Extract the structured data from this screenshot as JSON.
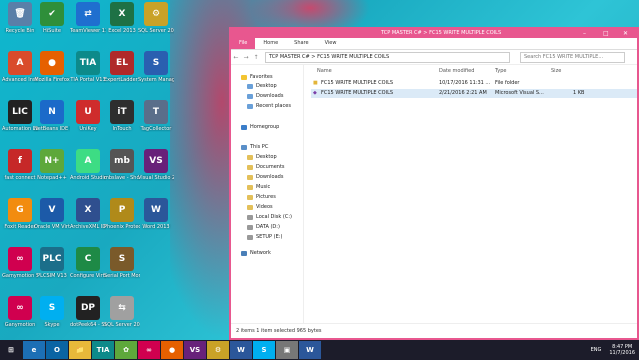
{
  "desktop": {
    "icons": [
      {
        "label": "Recycle Bin",
        "color": "#5a7fa8",
        "glyph": "🗑"
      },
      {
        "label": "HiSuite",
        "color": "#2f8f3a",
        "glyph": "✔"
      },
      {
        "label": "TeamViewer 11",
        "color": "#1f6fcf",
        "glyph": "⇄"
      },
      {
        "label": "Excel 2013",
        "color": "#1e7145",
        "glyph": "X"
      },
      {
        "label": "SQL Server 2014 Manag...",
        "color": "#c9a227",
        "glyph": "⚙"
      },
      {
        "label": "Advanced Installer 12.4",
        "color": "#d94b2b",
        "glyph": "A"
      },
      {
        "label": "Mozilla Firefox",
        "color": "#e66000",
        "glyph": "●"
      },
      {
        "label": "TIA Portal V13",
        "color": "#0d8a8a",
        "glyph": "TIA"
      },
      {
        "label": "ExpertLadder - Shortcut",
        "color": "#b02a2a",
        "glyph": "EL"
      },
      {
        "label": "System Manageme...",
        "color": "#2a5fb0",
        "glyph": "S"
      },
      {
        "label": "Automation License M...",
        "color": "#222",
        "glyph": "LIC"
      },
      {
        "label": "NetBeans IDE 8.2",
        "color": "#1b6ac9",
        "glyph": "N"
      },
      {
        "label": "UniKey",
        "color": "#cf2c2c",
        "glyph": "U"
      },
      {
        "label": "InTouch",
        "color": "#2e2e2e",
        "glyph": "iT"
      },
      {
        "label": "TagCollector",
        "color": "#5a6e8a",
        "glyph": "T"
      },
      {
        "label": "fast connect",
        "color": "#c62828",
        "glyph": "f"
      },
      {
        "label": "Notepad++",
        "color": "#5ea83b",
        "glyph": "N+"
      },
      {
        "label": "Android Studio",
        "color": "#3ddc84",
        "glyph": "A"
      },
      {
        "label": "mbslave - Shortcut",
        "color": "#555",
        "glyph": "mb"
      },
      {
        "label": "Visual Studio 2013",
        "color": "#68217a",
        "glyph": "VS"
      },
      {
        "label": "Foxit Reader",
        "color": "#f28c0f",
        "glyph": "G"
      },
      {
        "label": "Oracle VM VirtualBox",
        "color": "#1c5aa8",
        "glyph": "V"
      },
      {
        "label": "ArchiveXML IDE",
        "color": "#2f4f8f",
        "glyph": "X"
      },
      {
        "label": "Phoenix Protector",
        "color": "#b08a1a",
        "glyph": "P"
      },
      {
        "label": "Word 2013",
        "color": "#2b579a",
        "glyph": "W"
      },
      {
        "label": "Gamymotion Shell",
        "color": "#d0004f",
        "glyph": "∞"
      },
      {
        "label": "PLCSIM V13",
        "color": "#1b6e8a",
        "glyph": "PLC"
      },
      {
        "label": "Configure Virtual Seri...",
        "color": "#1e8a46",
        "glyph": "C"
      },
      {
        "label": "Serial Port Monitor",
        "color": "#7a5a2a",
        "glyph": "S"
      },
      {
        "label": "",
        "color": "transparent",
        "glyph": ""
      },
      {
        "label": "Ganymotion",
        "color": "#d0004f",
        "glyph": "∞"
      },
      {
        "label": "Skype",
        "color": "#00aff0",
        "glyph": "S"
      },
      {
        "label": "dotPeek64 - Shortcut",
        "color": "#222",
        "glyph": "DP"
      },
      {
        "label": "SQL Server 2014 Impo...",
        "color": "#a0a0a0",
        "glyph": "⇆"
      }
    ]
  },
  "window": {
    "title_path": "TCP MASTER C# > FC15 WRITE MULTIPLE COILS",
    "ribbon_tabs": [
      "File",
      "Home",
      "Share",
      "View"
    ],
    "address": "TCP MASTER C#  >  FC15 WRITE MULTIPLE COILS",
    "search_placeholder": "Search FC15 WRITE MULTIPLE...",
    "nav": {
      "favorites_label": "Favorites",
      "favorites": [
        "Desktop",
        "Downloads",
        "Recent places"
      ],
      "homegroup": "Homegroup",
      "thispc": "This PC",
      "thispc_items": [
        "Desktop",
        "Documents",
        "Downloads",
        "Music",
        "Pictures",
        "Videos",
        "Local Disk (C:)",
        "DATA (D:)",
        "SETUP (E:)"
      ],
      "network": "Network"
    },
    "columns": {
      "name": "Name",
      "date": "Date modified",
      "type": "Type",
      "size": "Size"
    },
    "files": [
      {
        "name": "FC15 WRITE MULTIPLE COILS",
        "date": "10/17/2016 11:31 ...",
        "type": "File folder",
        "size": ""
      },
      {
        "name": "FC15 WRITE MULTIPLE COILS",
        "date": "2/21/2016 2:21 AM",
        "type": "Microsoft Visual S...",
        "size": "1 KB"
      }
    ],
    "status": "2 items     1 item selected  965 bytes"
  },
  "taskbar": {
    "items": [
      "⊞",
      "e",
      "O",
      "📁",
      "TIA",
      "✿",
      "∞",
      "●",
      "VS",
      "⚙",
      "W",
      "S",
      "▣",
      "W"
    ],
    "language": "ENG",
    "time": "8:47 PM",
    "date": "11/7/2016"
  }
}
